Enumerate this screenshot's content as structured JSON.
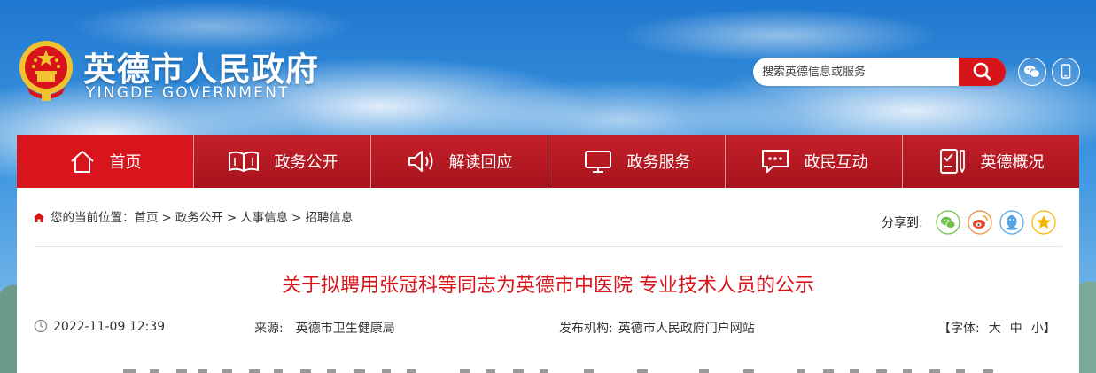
{
  "site": {
    "name": "英德市人民政府",
    "name_en": "YINGDE GOVERNMENT"
  },
  "search": {
    "placeholder": "搜索英德信息或服务"
  },
  "header_icons": [
    "search-icon",
    "wechat-icon",
    "mobile-icon"
  ],
  "nav": {
    "items": [
      {
        "label": "首页",
        "icon": "home-icon",
        "active": true
      },
      {
        "label": "政务公开",
        "icon": "book-icon"
      },
      {
        "label": "解读回应",
        "icon": "speaker-icon"
      },
      {
        "label": "政务服务",
        "icon": "monitor-icon"
      },
      {
        "label": "政民互动",
        "icon": "chat-icon"
      },
      {
        "label": "英德概况",
        "icon": "checklist-icon"
      }
    ]
  },
  "breadcrumb": {
    "prefix": "您的当前位置：",
    "items": [
      "首页",
      "政务公开",
      "人事信息",
      "招聘信息"
    ],
    "separator": ">"
  },
  "share": {
    "label": "分享到:",
    "icons": [
      "wechat-share-icon",
      "weibo-share-icon",
      "qq-share-icon",
      "favorite-share-icon"
    ]
  },
  "article": {
    "title": "关于拟聘用张冠科等同志为英德市中医院 专业技术人员的公示",
    "date": "2022-11-09 12:39",
    "source_label": "来源:",
    "source": "英德市卫生健康局",
    "publisher_label": "发布机构:",
    "publisher": "英德市人民政府门户网站",
    "font_label": "【字体:",
    "font_sizes": [
      "大",
      "中",
      "小"
    ],
    "font_close": "】"
  },
  "colors": {
    "brand_red": "#d8141b",
    "nav_red": "#b71a22",
    "title_red": "#d8141b"
  }
}
